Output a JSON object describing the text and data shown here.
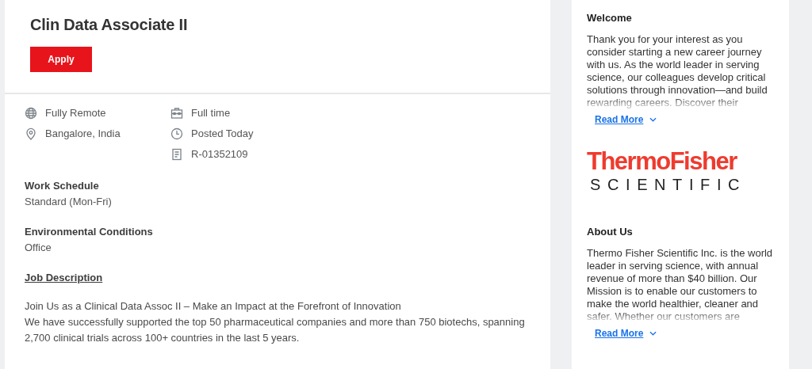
{
  "job": {
    "title": "Clin Data Associate II",
    "apply_button": "Apply",
    "meta_columns": [
      [
        {
          "kind": "globe",
          "text": "Fully Remote"
        },
        {
          "kind": "pin",
          "text": "Bangalore, India"
        }
      ],
      [
        {
          "kind": "briefcase",
          "text": "Full time"
        },
        {
          "kind": "clock",
          "text": "Posted Today"
        },
        {
          "kind": "document",
          "text": "R-01352109"
        }
      ]
    ],
    "fields": [
      {
        "label": "Work Schedule",
        "value": "Standard (Mon-Fri)"
      },
      {
        "label": "Environmental Conditions",
        "value": "Office"
      }
    ],
    "description_heading": "Job Description",
    "description_lines": [
      "Join Us as a Clinical Data Assoc II – Make an Impact at the Forefront of Innovation",
      "We have successfully supported the top 50 pharmaceutical companies and more than 750 biotechs, spanning 2,700 clinical trials across 100+ countries in the last 5 years."
    ]
  },
  "sidebar": {
    "sections": [
      {
        "kind": "text",
        "heading": "Welcome",
        "body": "Thank you for your interest as you consider starting a new career journey with us. As the world leader in serving science, our colleagues develop critical solutions through innovation—and build rewarding careers. Discover their",
        "link": "Read More"
      },
      {
        "kind": "logo",
        "line1": "ThermoFisher",
        "line2": "SCIENTIFIC"
      },
      {
        "kind": "text",
        "heading": "About Us",
        "body": "Thermo Fisher Scientific Inc. is the world leader in serving science, with annual revenue of more than $40 billion. Our Mission is to enable our customers to make the world healthier, cleaner and safer. Whether our customers are",
        "link": "Read More"
      }
    ]
  }
}
